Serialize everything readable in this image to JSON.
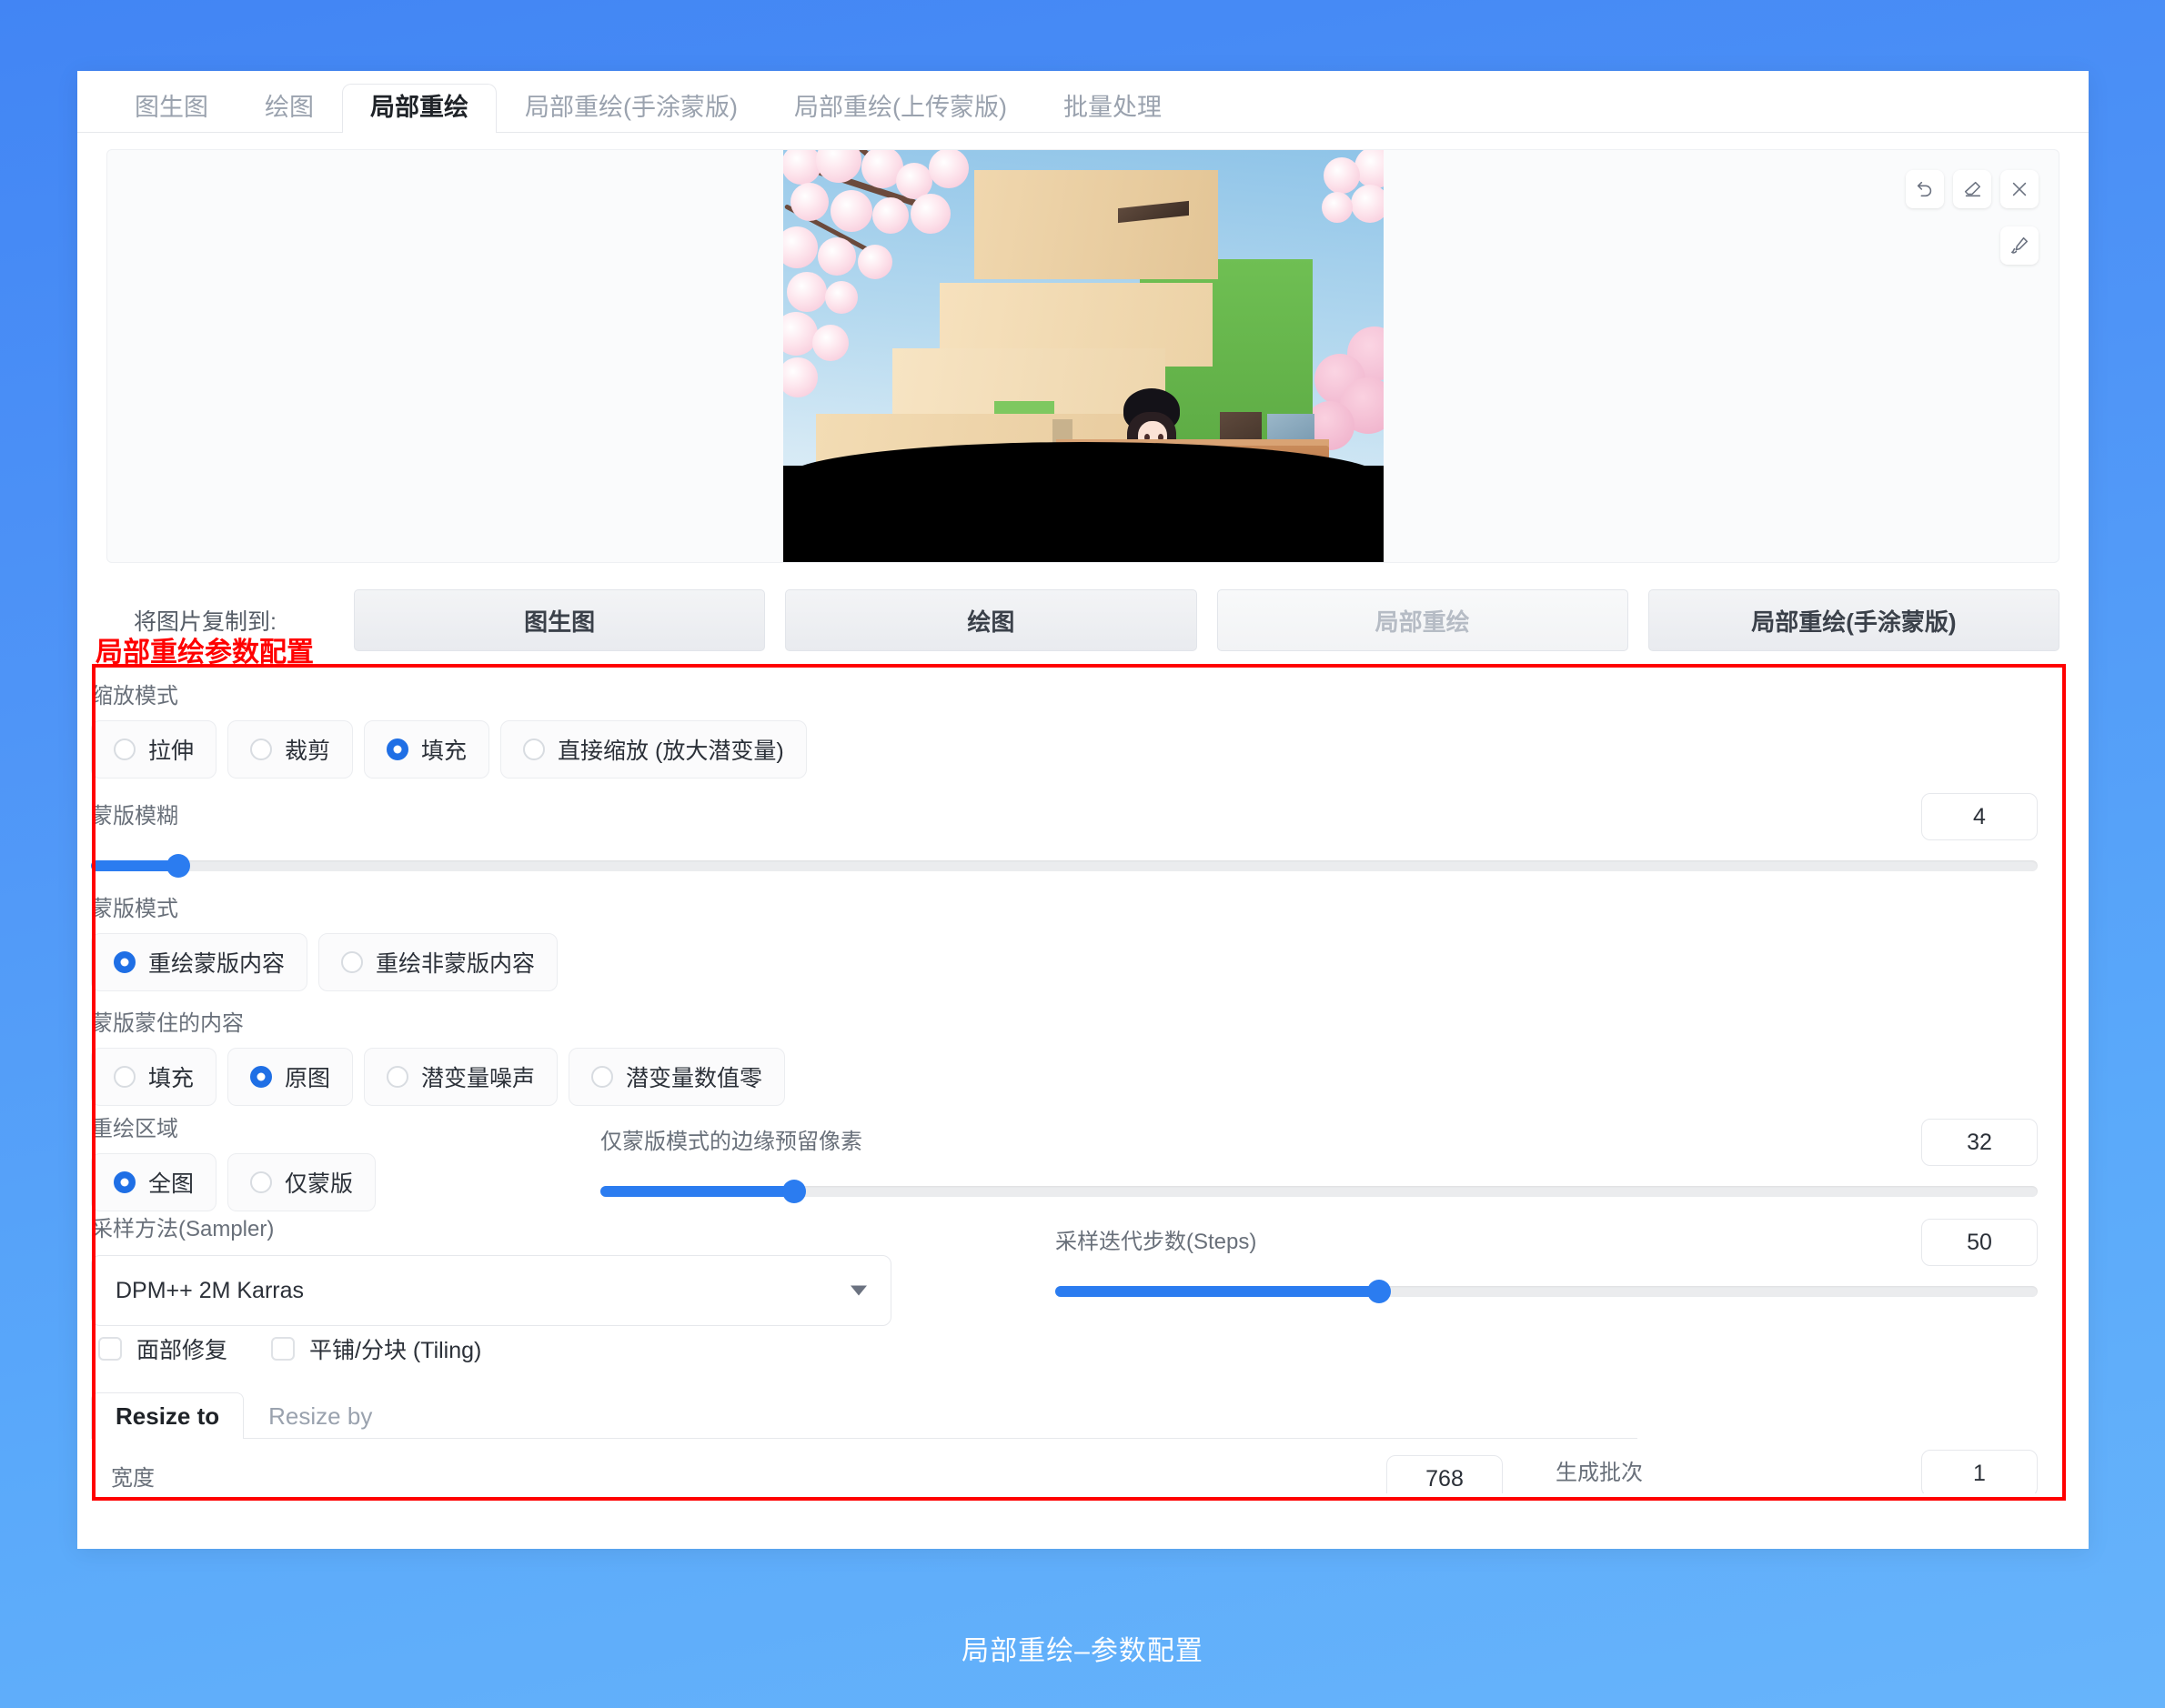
{
  "window": {
    "caption": "局部重绘–参数配置",
    "annotation": "局部重绘参数配置"
  },
  "tabs": [
    {
      "label": "图生图",
      "active": false
    },
    {
      "label": "绘图",
      "active": false
    },
    {
      "label": "局部重绘",
      "active": true
    },
    {
      "label": "局部重绘(手涂蒙版)",
      "active": false
    },
    {
      "label": "局部重绘(上传蒙版)",
      "active": false
    },
    {
      "label": "批量处理",
      "active": false
    }
  ],
  "stage": {
    "tools": [
      {
        "name": "undo-icon",
        "title": "撤销"
      },
      {
        "name": "eraser-icon",
        "title": "橡皮擦"
      },
      {
        "name": "close-icon",
        "title": "关闭"
      }
    ],
    "brush_tool": {
      "name": "brush-icon",
      "title": "画笔"
    }
  },
  "copy_to": {
    "label": "将图片复制到:",
    "buttons": [
      {
        "label": "图生图",
        "muted": false
      },
      {
        "label": "绘图",
        "muted": false
      },
      {
        "label": "局部重绘",
        "muted": true
      },
      {
        "label": "局部重绘(手涂蒙版)",
        "muted": false
      }
    ]
  },
  "params": {
    "resize_mode": {
      "label": "缩放模式",
      "options": [
        {
          "label": "拉伸",
          "selected": false
        },
        {
          "label": "裁剪",
          "selected": false
        },
        {
          "label": "填充",
          "selected": true
        },
        {
          "label": "直接缩放 (放大潜变量)",
          "selected": false
        }
      ]
    },
    "mask_blur": {
      "label": "蒙版模糊",
      "value": "4",
      "percent": 4.5
    },
    "mask_mode": {
      "label": "蒙版模式",
      "options": [
        {
          "label": "重绘蒙版内容",
          "selected": true
        },
        {
          "label": "重绘非蒙版内容",
          "selected": false
        }
      ]
    },
    "masked_content": {
      "label": "蒙版蒙住的内容",
      "options": [
        {
          "label": "填充",
          "selected": false
        },
        {
          "label": "原图",
          "selected": true
        },
        {
          "label": "潜变量噪声",
          "selected": false
        },
        {
          "label": "潜变量数值零",
          "selected": false
        }
      ]
    },
    "inpaint_area": {
      "label": "重绘区域",
      "options": [
        {
          "label": "全图",
          "selected": true
        },
        {
          "label": "仅蒙版",
          "selected": false
        }
      ]
    },
    "mask_padding": {
      "label": "仅蒙版模式的边缘预留像素",
      "value": "32",
      "percent": 13.5
    },
    "sampler": {
      "label": "采样方法(Sampler)",
      "value": "DPM++ 2M Karras"
    },
    "steps": {
      "label": "采样迭代步数(Steps)",
      "value": "50",
      "percent": 33
    },
    "checkboxes": [
      {
        "label": "面部修复",
        "checked": false
      },
      {
        "label": "平铺/分块 (Tiling)",
        "checked": false
      }
    ],
    "resize_tabs": [
      {
        "label": "Resize to",
        "active": true
      },
      {
        "label": "Resize by",
        "active": false
      }
    ],
    "width": {
      "label": "宽度",
      "value": "768",
      "percent": 36
    },
    "batch_count": {
      "label": "生成批次",
      "value": "1",
      "percent": 1
    }
  }
}
